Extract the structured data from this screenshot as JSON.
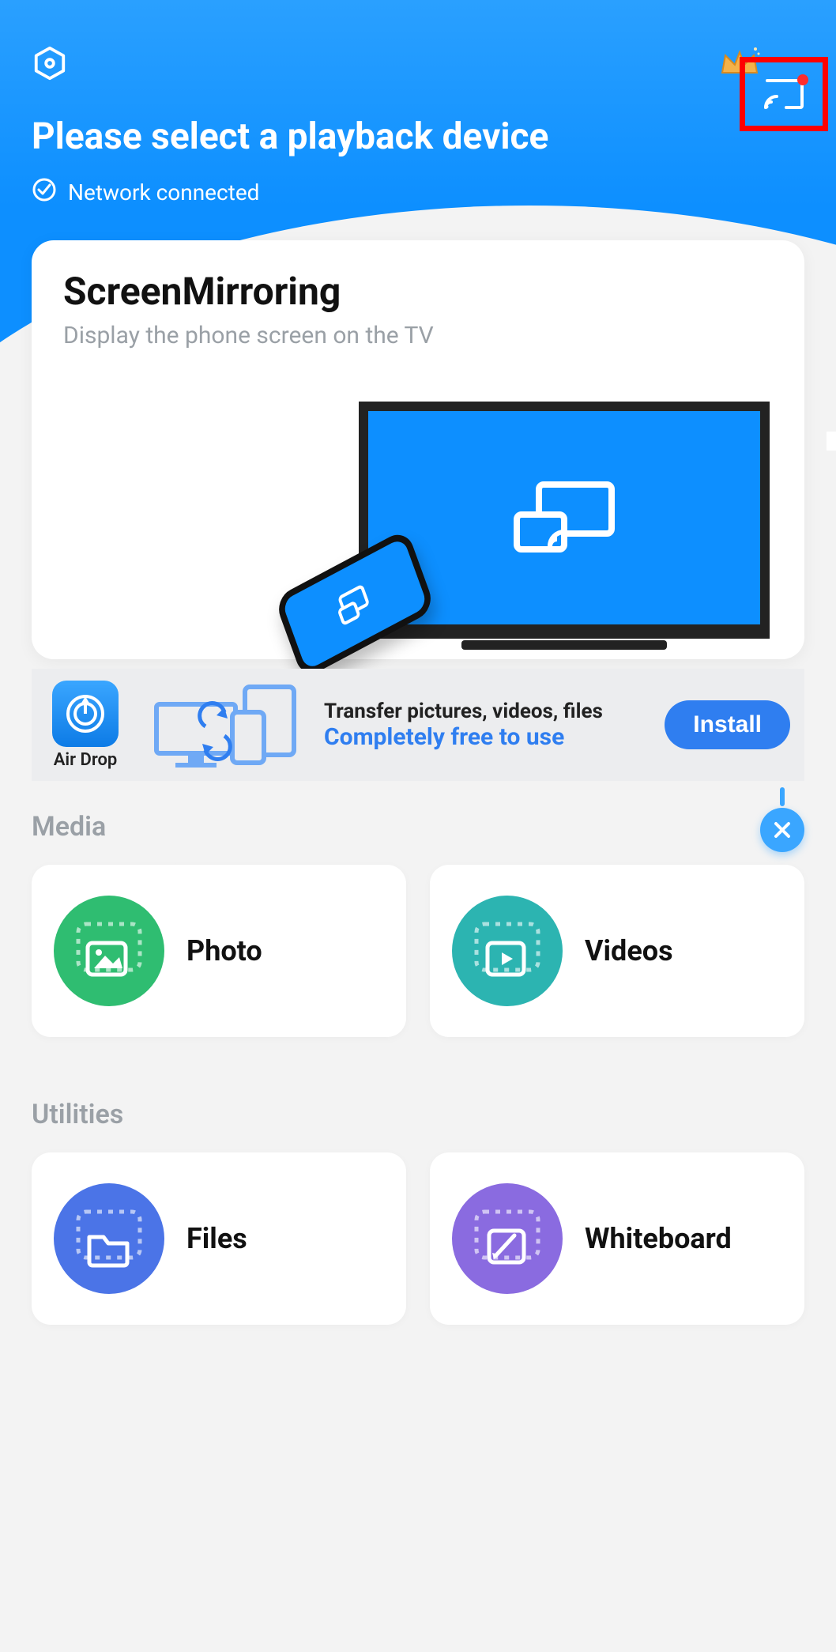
{
  "header": {
    "title": "Please select a playback device",
    "network_status": "Network connected"
  },
  "main_card": {
    "title": "ScreenMirroring",
    "subtitle": "Display the phone screen on the TV"
  },
  "ad": {
    "app_name": "Air Drop",
    "line1": "Transfer pictures, videos, files",
    "line2": "Completely free to use",
    "cta": "Install"
  },
  "sections": {
    "media": {
      "title": "Media",
      "tiles": [
        {
          "label": "Photo"
        },
        {
          "label": "Videos"
        }
      ]
    },
    "utilities": {
      "title": "Utilities",
      "tiles": [
        {
          "label": "Files"
        },
        {
          "label": "Whiteboard"
        }
      ]
    }
  },
  "colors": {
    "accent": "#0d8fff",
    "highlight_box": "#ff0000"
  }
}
